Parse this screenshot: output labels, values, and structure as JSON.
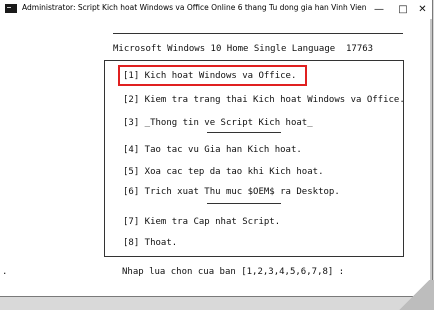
{
  "window": {
    "title": "Administrator: Script Kich hoat Windows va Office Online 6 thang Tu dong gia han Vinh Vien - Copyright (C) All ri...",
    "min_glyph": "—",
    "max_glyph": "□",
    "close_glyph": "✕"
  },
  "console": {
    "os_line": "Microsoft Windows 10 Home Single Language  17763",
    "menu": [
      "[1] Kich hoat Windows va Office.",
      "[2] Kiem tra trang thai Kich hoat Windows va Office.",
      "[3] _Thong tin ve Script Kich hoat_",
      "[4] Tao tac vu Gia han Kich hoat.",
      "[5] Xoa cac tep da tao khi Kich hoat.",
      "[6] Trich xuat Thu muc $OEM$ ra Desktop.",
      "[7] Kiem tra Cap nhat Script.",
      "[8] Thoat."
    ],
    "prompt": "Nhap lua chon cua ban [1,2,3,4,5,6,7,8] :",
    "left_dot": "."
  },
  "colors": {
    "highlight": "#e02020",
    "text": "#111111"
  }
}
